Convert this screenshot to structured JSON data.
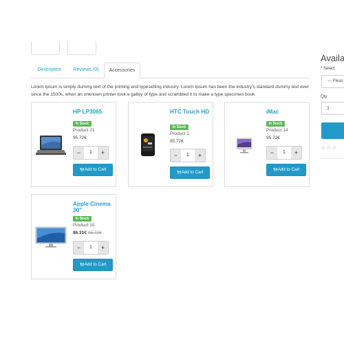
{
  "tabs": [
    {
      "label": "Description"
    },
    {
      "label": "Reviews (0)"
    },
    {
      "label": "Accessories"
    }
  ],
  "description": "Lorem Ipsum is simply dummy text of the printing and typesetting industry. Lorem Ipsum has been the industry's standard dummy text ever since the 1500s, when an unknown printer took a galley of type and scrambled it to make a type specimen book",
  "products": [
    {
      "name": "HP LP3065",
      "stock": "In Stock",
      "code": "Product 21",
      "price": "95.72€",
      "qty": "1",
      "cart_label": "Add to Cart",
      "icon": "laptop-icon"
    },
    {
      "name": "HTC Touch HD",
      "stock": "In Stock",
      "code": "Product 1",
      "price": "95.72€",
      "qty": "1",
      "cart_label": "Add to Cart",
      "icon": "phone-icon"
    },
    {
      "name": "iMac",
      "stock": "In Stock",
      "code": "Product 14",
      "price": "95.72€",
      "qty": "1",
      "cart_label": "Add to Cart",
      "icon": "imac-icon"
    },
    {
      "name": "Apple Cinema 30\"",
      "stock": "In Stock",
      "code": "Product 15",
      "price_special": "86.31€",
      "price_old": "95.72€",
      "qty": "1",
      "cart_label": "Add to Cart",
      "icon": "monitor-icon"
    }
  ],
  "qty_controls": {
    "minus": "−",
    "plus": "+"
  },
  "sidebar": {
    "title": "Availab",
    "select_required": "*",
    "select_label": "Select",
    "select_value": "--- Pleas",
    "qty_label": "Qty",
    "qty_value": "1",
    "stars": "☆☆☆"
  },
  "colors": {
    "accent": "#23a1d1",
    "button": "#229ac8",
    "in_stock": "#5cb85c"
  }
}
